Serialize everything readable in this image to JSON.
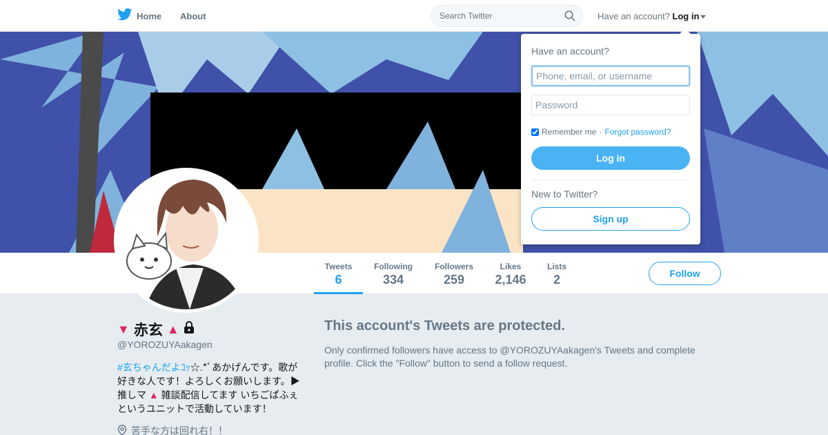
{
  "nav": {
    "home_label": "Home",
    "about_label": "About",
    "search_placeholder": "Search Twitter",
    "have_account": "Have an account?",
    "login_label": "Log in",
    "brand_color": "#1da1f2"
  },
  "profile": {
    "name": "赤玄",
    "name_prefix_icon": "▼",
    "name_suffix_icon": "▲",
    "handle": "@YOROZUYAakagen",
    "bio_hashtag": "#玄ちゃんだよｺｯ",
    "bio_text": "☆.*ﾟあかげんです。歌が好きな人です！よろしくお願いします。▶推しマ ",
    "bio_triangle": "▲",
    "bio_text2": " 雑談配信してます いちごぱふぇというユニットで活動しています！",
    "location": "苦手な方は回れ右！！"
  },
  "stats": [
    {
      "label": "Tweets",
      "value": "6"
    },
    {
      "label": "Following",
      "value": "334"
    },
    {
      "label": "Followers",
      "value": "259"
    },
    {
      "label": "Likes",
      "value": "2,146"
    },
    {
      "label": "Lists",
      "value": "2"
    }
  ],
  "follow_label": "Follow",
  "protected": {
    "title": "This account's Tweets are protected.",
    "text": "Only confirmed followers have access to @YOROZUYAakagen's Tweets and complete profile. Click the \"Follow\" button to send a follow request."
  },
  "login_dropdown": {
    "title": "Have an account?",
    "username_placeholder": "Phone, email, or username",
    "password_placeholder": "Password",
    "remember_label": "Remember me",
    "separator": " · ",
    "forgot_label": "Forgot password?",
    "login_button": "Log in",
    "new_label": "New to Twitter?",
    "signup_button": "Sign up"
  }
}
